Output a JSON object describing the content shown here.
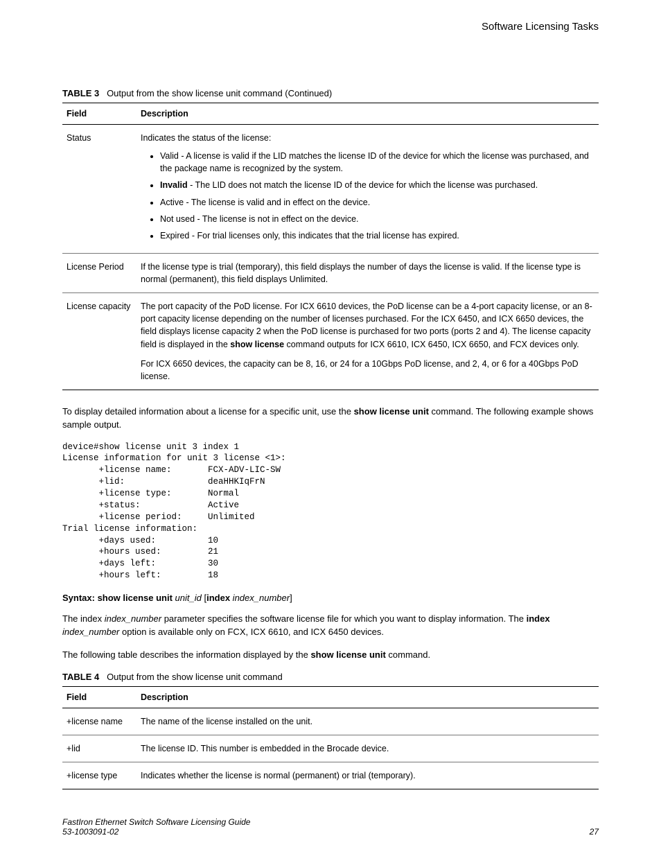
{
  "header": {
    "section": "Software Licensing Tasks"
  },
  "table3": {
    "label": "TABLE 3",
    "title": "Output from the show license unit command (Continued)",
    "col_field": "Field",
    "col_desc": "Description",
    "rows": {
      "status": {
        "field": "Status",
        "intro": "Indicates the status of the license:",
        "b1a": "Valid - A license is valid if the LID matches the license ID of the device for which the license was purchased, and the package name is recognized by the system.",
        "b2_strong": "Invalid",
        "b2_rest": " - The LID does not match the license ID of the device for which the license was purchased.",
        "b3": "Active - The license is valid and in effect on the device.",
        "b4": "Not used - The license is not in effect on the device.",
        "b5": "Expired - For trial licenses only, this indicates that the trial license has expired."
      },
      "period": {
        "field": "License Period",
        "desc": "If the license type is trial (temporary), this field displays the number of days the license is valid. If the license type is normal (permanent), this field displays Unlimited."
      },
      "capacity": {
        "field": "License capacity",
        "p1a": "The port capacity of the PoD license. For ICX 6610 devices, the PoD license can be a 4-port capacity license, or an 8-port capacity license depending on the number of licenses purchased. For the ICX 6450, and ICX 6650 devices, the field displays license capacity 2 when the PoD license is purchased for two ports (ports 2 and 4). The license capacity field is displayed in the ",
        "p1_strong": "show license",
        "p1b": " command outputs for ICX 6610, ICX 6450, ICX 6650, and FCX devices only.",
        "p2": "For ICX 6650 devices, the capacity can be 8, 16, or 24 for a 10Gbps PoD license, and 2, 4, or 6 for a 40Gbps PoD license."
      }
    }
  },
  "para1a": "To display detailed information about a license for a specific unit, use the ",
  "para1b": "show license unit",
  "para1c": " command. The following example shows sample output.",
  "code": "device#show license unit 3 index 1\nLicense information for unit 3 license <1>:\n       +license name:       FCX-ADV-LIC-SW\n       +lid:                deaHHKIqFrN\n       +license type:       Normal\n       +status:             Active\n       +license period:     Unlimited\nTrial license information:\n       +days used:          10\n       +hours used:         21\n       +days left:          30\n       +hours left:         18",
  "syntax": {
    "prefix": "Syntax: show license unit",
    "arg1": " unit_id",
    "lbr": " [",
    "idx": "index",
    "arg2": " index_number",
    "rbr": "]"
  },
  "para2a": "The index ",
  "para2b": "index_number",
  "para2c": " parameter specifies the software license file for which you want to display information. The ",
  "para2d": "index",
  "para2e": " index_number",
  "para2f": " option is available only on FCX, ICX 6610, and ICX 6450 devices.",
  "para3a": "The following table describes the information displayed by the ",
  "para3b": "show license unit",
  "para3c": " command.",
  "table4": {
    "label": "TABLE 4",
    "title": "Output from the show license unit command",
    "col_field": "Field",
    "col_desc": "Description",
    "rows": {
      "name": {
        "field": "+license name",
        "desc": "The name of the license installed on the unit."
      },
      "lid": {
        "field": "+lid",
        "desc": "The license ID. This number is embedded in the Brocade device."
      },
      "type": {
        "field": "+license type",
        "desc": "Indicates whether the license is normal (permanent) or trial (temporary)."
      }
    }
  },
  "footer": {
    "title": "FastIron Ethernet Switch Software Licensing Guide",
    "docnum": "53-1003091-02",
    "page": "27"
  }
}
